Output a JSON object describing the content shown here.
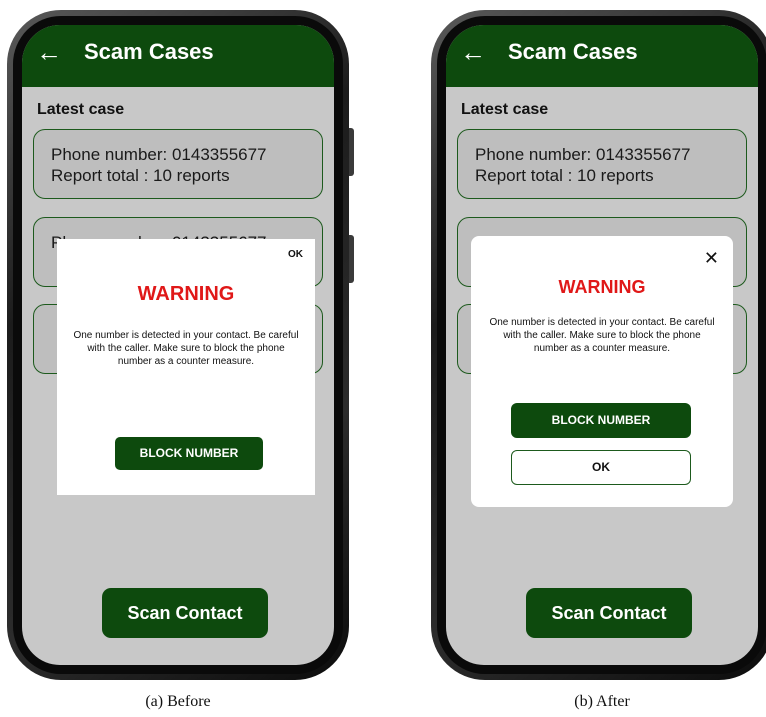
{
  "before": {
    "app_bar": {
      "back_icon": "arrow-left-icon",
      "title": "Scam Cases"
    },
    "section_label": "Latest case",
    "cards": [
      {
        "line1": "Phone number: 0143355677",
        "line2": "Report total : 10 reports"
      },
      {
        "line1": "Phone number: 0143355677",
        "line2": ""
      },
      {
        "line1": "",
        "line2": ""
      }
    ],
    "dialog": {
      "ok_text": "OK",
      "heading": "WARNING",
      "message": "One number is detected in your contact. Be careful with the caller. Make sure to block the phone number as a counter measure.",
      "block_label": "BLOCK NUMBER"
    },
    "scan_button": "Scan Contact",
    "caption": "(a) Before"
  },
  "after": {
    "app_bar": {
      "back_icon": "arrow-left-icon",
      "title": "Scam Cases"
    },
    "section_label": "Latest case",
    "cards": [
      {
        "line1": "Phone number: 0143355677",
        "line2": "Report total : 10 reports"
      },
      {
        "line1": "",
        "line2": ""
      },
      {
        "line1": "",
        "line2": ""
      }
    ],
    "dialog": {
      "close_icon": "close-icon",
      "heading": "WARNING",
      "message": "One number is detected in your contact. Be careful with the caller. Make sure to block the phone number as a counter measure.",
      "block_label": "BLOCK NUMBER",
      "ok_label": "OK"
    },
    "scan_button": "Scan Contact",
    "caption": "(b) After"
  },
  "colors": {
    "app_green": "#0d4a0d",
    "warning_red": "#e01818",
    "screen_gray": "#c8c8c8"
  }
}
